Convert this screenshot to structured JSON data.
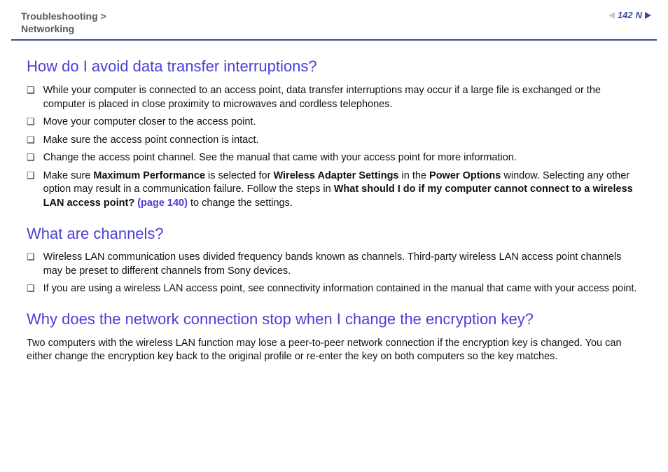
{
  "breadcrumb": {
    "line1": "Troubleshooting >",
    "line2": "Networking"
  },
  "page_number": "142",
  "n_label": "N",
  "section1": {
    "heading": "How do I avoid data transfer interruptions?",
    "items": [
      {
        "text": "While your computer is connected to an access point, data transfer interruptions may occur if a large file is exchanged or the computer is placed in close proximity to microwaves and cordless telephones."
      },
      {
        "text": "Move your computer closer to the access point."
      },
      {
        "text": "Make sure the access point connection is intact."
      },
      {
        "text": "Change the access point channel. See the manual that came with your access point for more information."
      }
    ],
    "item5": {
      "pre": "Make sure ",
      "b1": "Maximum Performance",
      "mid1": " is selected for ",
      "b2": "Wireless Adapter Settings",
      "mid2": " in the ",
      "b3": "Power Options",
      "mid3": " window. Selecting any other option may result in a communication failure. Follow the steps in ",
      "b4": "What should I do if my computer cannot connect to a wireless LAN access point? ",
      "link": "(page 140)",
      "post": " to change the settings."
    }
  },
  "section2": {
    "heading": "What are channels?",
    "items": [
      {
        "text": "Wireless LAN communication uses divided frequency bands known as channels. Third-party wireless LAN access point channels may be preset to different channels from Sony devices."
      },
      {
        "text": "If you are using a wireless LAN access point, see connectivity information contained in the manual that came with your access point."
      }
    ]
  },
  "section3": {
    "heading": "Why does the network connection stop when I change the encryption key?",
    "para": "Two computers with the wireless LAN function may lose a peer-to-peer network connection if the encryption key is changed. You can either change the encryption key back to the original profile or re-enter the key on both computers so the key matches."
  },
  "bullet_char": "❑"
}
